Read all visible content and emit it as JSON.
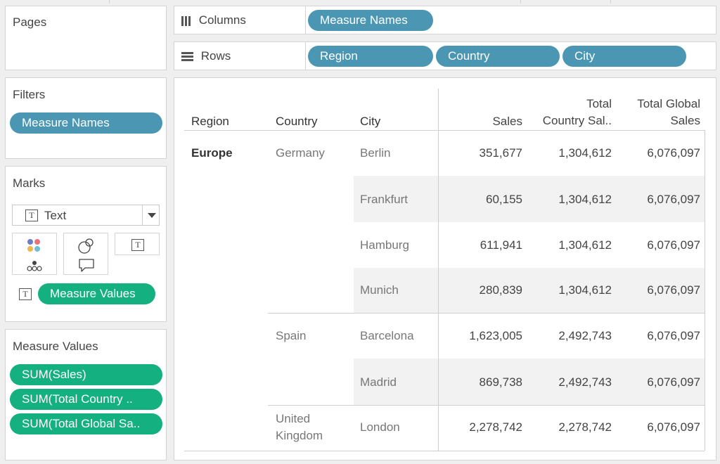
{
  "shelves": {
    "pages_label": "Pages",
    "filters_label": "Filters",
    "filters": [
      "Measure Names"
    ],
    "columns_label": "Columns",
    "columns": [
      "Measure Names"
    ],
    "rows_label": "Rows",
    "rows": [
      "Region",
      "Country",
      "City"
    ]
  },
  "marks": {
    "title": "Marks",
    "mark_type": "Text",
    "value_pill": "Measure Values"
  },
  "measure_values": {
    "title": "Measure Values",
    "items": [
      "SUM(Sales)",
      "SUM(Total Country ..",
      "SUM(Total Global Sa.."
    ]
  },
  "table": {
    "headers": {
      "region": "Region",
      "country": "Country",
      "city": "City",
      "sales": "Sales",
      "country_sales_line1": "Total",
      "country_sales_line2": "Country Sal..",
      "global_sales_line1": "Total Global",
      "global_sales_line2": "Sales"
    },
    "region": "Europe",
    "countries": [
      {
        "line1": "Germany",
        "line2": ""
      },
      {
        "line1": "Spain",
        "line2": ""
      },
      {
        "line1": "United",
        "line2": "Kingdom"
      }
    ],
    "rows": [
      {
        "city": "Berlin",
        "sales": "351,677",
        "country_sales": "1,304,612",
        "global_sales": "6,076,097"
      },
      {
        "city": "Frankfurt",
        "sales": "60,155",
        "country_sales": "1,304,612",
        "global_sales": "6,076,097"
      },
      {
        "city": "Hamburg",
        "sales": "611,941",
        "country_sales": "1,304,612",
        "global_sales": "6,076,097"
      },
      {
        "city": "Munich",
        "sales": "280,839",
        "country_sales": "1,304,612",
        "global_sales": "6,076,097"
      },
      {
        "city": "Barcelona",
        "sales": "1,623,005",
        "country_sales": "2,492,743",
        "global_sales": "6,076,097"
      },
      {
        "city": "Madrid",
        "sales": "869,738",
        "country_sales": "2,492,743",
        "global_sales": "6,076,097"
      },
      {
        "city": "London",
        "sales": "2,278,742",
        "country_sales": "2,278,742",
        "global_sales": "6,076,097"
      }
    ]
  },
  "colors": {
    "dimension_pill": "#4b97b3",
    "measure_pill": "#14b07f"
  }
}
